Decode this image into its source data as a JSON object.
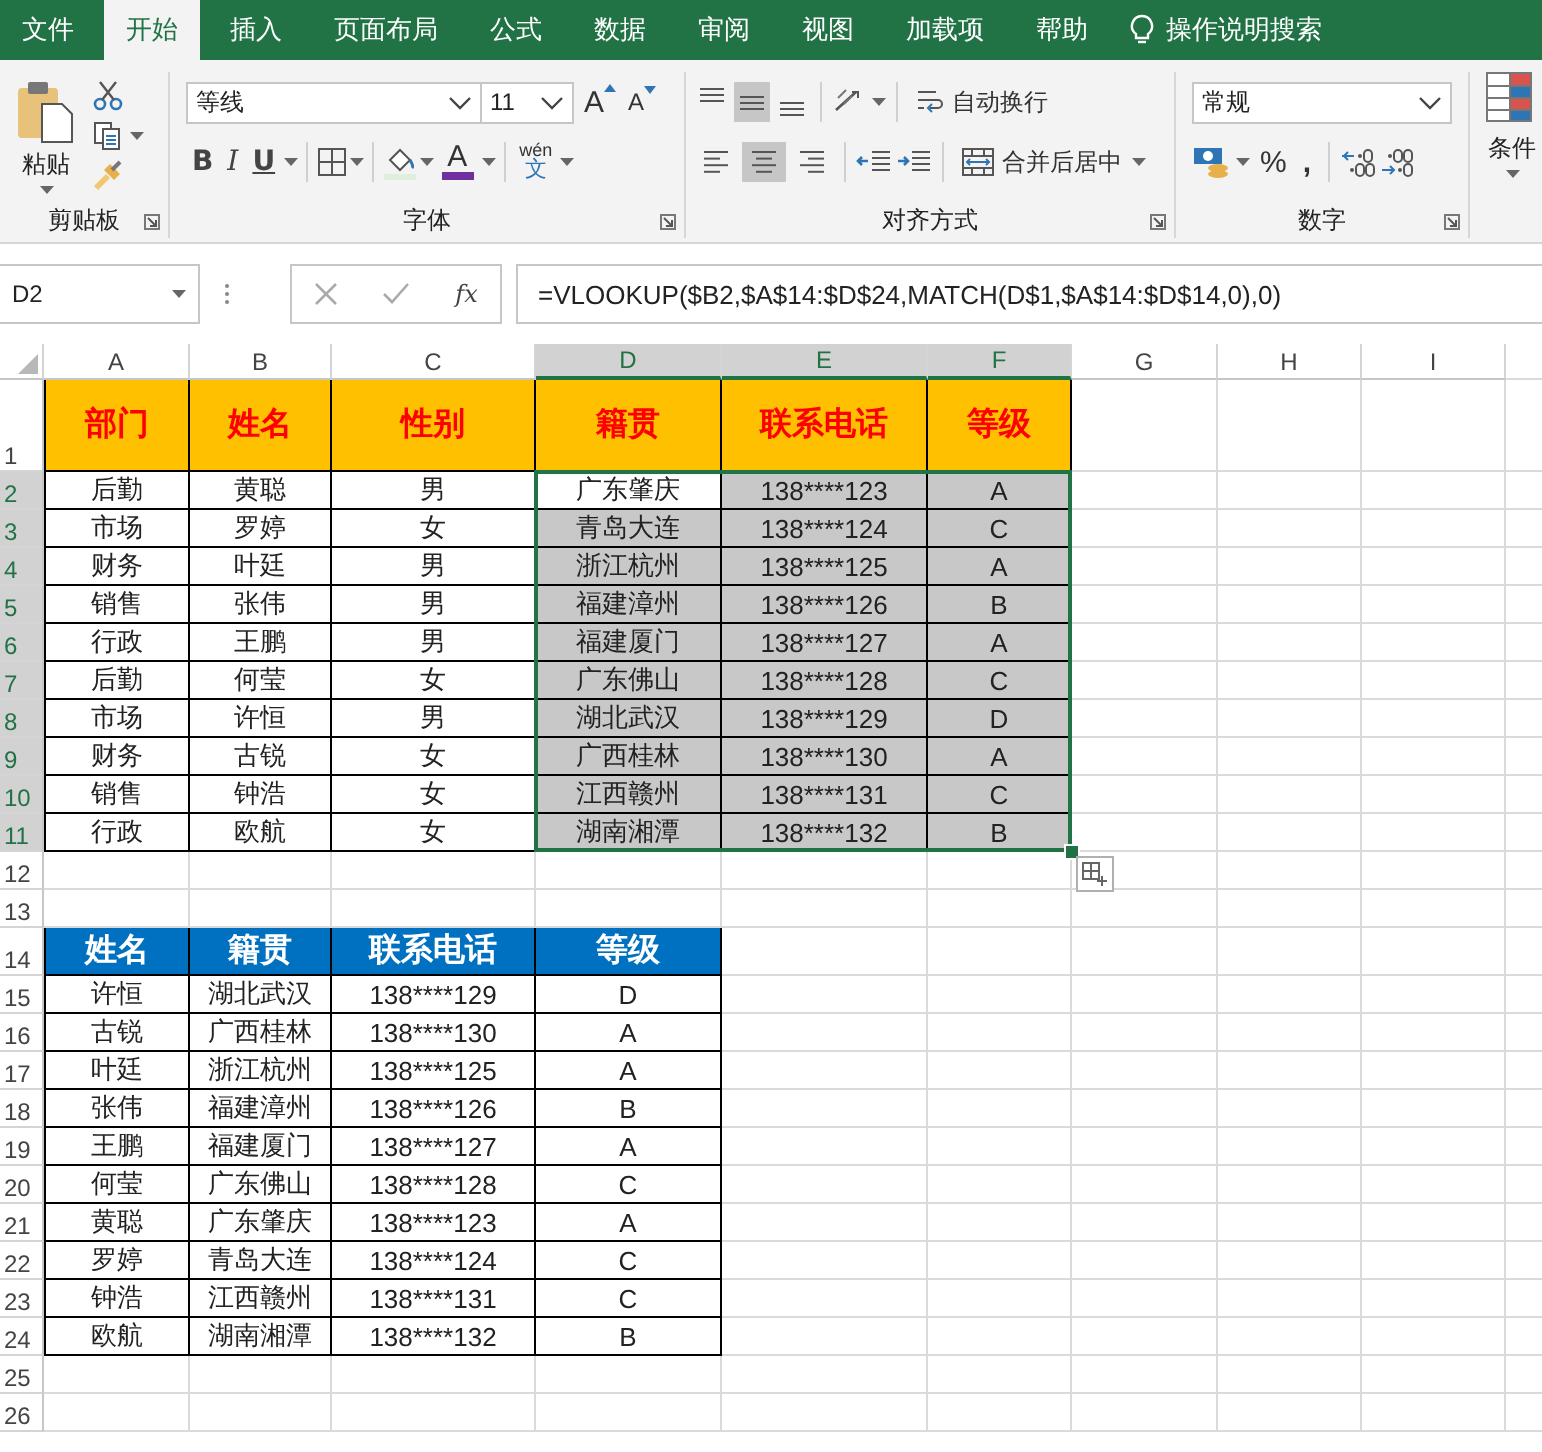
{
  "menu_tabs": [
    {
      "label": "文件",
      "selected": false
    },
    {
      "label": "开始",
      "selected": true
    },
    {
      "label": "插入",
      "selected": false
    },
    {
      "label": "页面布局",
      "selected": false
    },
    {
      "label": "公式",
      "selected": false
    },
    {
      "label": "数据",
      "selected": false
    },
    {
      "label": "审阅",
      "selected": false
    },
    {
      "label": "视图",
      "selected": false
    },
    {
      "label": "加载项",
      "selected": false
    },
    {
      "label": "帮助",
      "selected": false
    }
  ],
  "tell_me": "操作说明搜索",
  "ribbon": {
    "clipboard": {
      "paste": "粘贴",
      "group": "剪贴板"
    },
    "font": {
      "name": "等线",
      "size": "11",
      "grow": "A",
      "shrink": "A",
      "bold": "B",
      "italic": "I",
      "underline": "U",
      "font_color": "A",
      "phonetic_top": "wén",
      "phonetic_bottom": "文",
      "group": "字体"
    },
    "alignment": {
      "vertical": [
        {
          "selected": false
        },
        {
          "selected": true
        },
        {
          "selected": false
        }
      ],
      "horizontal": [
        {
          "selected": false
        },
        {
          "selected": true
        },
        {
          "selected": false
        }
      ],
      "wrap": "自动换行",
      "merge": "合并后居中",
      "group": "对齐方式"
    },
    "number": {
      "format": "常规",
      "percent": "%",
      "comma": ",",
      "group": "数字"
    },
    "styles": {
      "conditional": "条件"
    }
  },
  "formula_bar": {
    "name_box": "D2",
    "function_label": "fx",
    "formula": "=VLOOKUP($B2,$A$14:$D$24,MATCH(D$1,$A$14:$D$14,0),0)"
  },
  "sheet": {
    "columns": [
      {
        "label": "A",
        "selected": false
      },
      {
        "label": "B",
        "selected": false
      },
      {
        "label": "C",
        "selected": false
      },
      {
        "label": "D",
        "selected": true
      },
      {
        "label": "E",
        "selected": true
      },
      {
        "label": "F",
        "selected": true
      },
      {
        "label": "G",
        "selected": false
      },
      {
        "label": "H",
        "selected": false
      },
      {
        "label": "I",
        "selected": false
      }
    ],
    "rows": [
      {
        "number": "1",
        "selected": false,
        "cells": [
          {
            "text": "部门",
            "kind": "title"
          },
          {
            "text": "姓名",
            "kind": "title"
          },
          {
            "text": "性别",
            "kind": "title"
          },
          {
            "text": "籍贯",
            "kind": "title"
          },
          {
            "text": "联系电话",
            "kind": "title"
          },
          {
            "text": "等级",
            "kind": "title"
          }
        ]
      },
      {
        "number": "2",
        "selected": true,
        "cells": [
          {
            "text": "后勤",
            "kind": "data"
          },
          {
            "text": "黄聪",
            "kind": "data"
          },
          {
            "text": "男",
            "kind": "data"
          },
          {
            "text": "广东肇庆",
            "kind": "active"
          },
          {
            "text": "138****123",
            "kind": "highlight"
          },
          {
            "text": "A",
            "kind": "highlight"
          }
        ]
      },
      {
        "number": "3",
        "selected": true,
        "cells": [
          {
            "text": "市场",
            "kind": "data"
          },
          {
            "text": "罗婷",
            "kind": "data"
          },
          {
            "text": "女",
            "kind": "data"
          },
          {
            "text": "青岛大连",
            "kind": "highlight"
          },
          {
            "text": "138****124",
            "kind": "highlight"
          },
          {
            "text": "C",
            "kind": "highlight"
          }
        ]
      },
      {
        "number": "4",
        "selected": true,
        "cells": [
          {
            "text": "财务",
            "kind": "data"
          },
          {
            "text": "叶廷",
            "kind": "data"
          },
          {
            "text": "男",
            "kind": "data"
          },
          {
            "text": "浙江杭州",
            "kind": "highlight"
          },
          {
            "text": "138****125",
            "kind": "highlight"
          },
          {
            "text": "A",
            "kind": "highlight"
          }
        ]
      },
      {
        "number": "5",
        "selected": true,
        "cells": [
          {
            "text": "销售",
            "kind": "data"
          },
          {
            "text": "张伟",
            "kind": "data"
          },
          {
            "text": "男",
            "kind": "data"
          },
          {
            "text": "福建漳州",
            "kind": "highlight"
          },
          {
            "text": "138****126",
            "kind": "highlight"
          },
          {
            "text": "B",
            "kind": "highlight"
          }
        ]
      },
      {
        "number": "6",
        "selected": true,
        "cells": [
          {
            "text": "行政",
            "kind": "data"
          },
          {
            "text": "王鹏",
            "kind": "data"
          },
          {
            "text": "男",
            "kind": "data"
          },
          {
            "text": "福建厦门",
            "kind": "highlight"
          },
          {
            "text": "138****127",
            "kind": "highlight"
          },
          {
            "text": "A",
            "kind": "highlight"
          }
        ]
      },
      {
        "number": "7",
        "selected": true,
        "cells": [
          {
            "text": "后勤",
            "kind": "data"
          },
          {
            "text": "何莹",
            "kind": "data"
          },
          {
            "text": "女",
            "kind": "data"
          },
          {
            "text": "广东佛山",
            "kind": "highlight"
          },
          {
            "text": "138****128",
            "kind": "highlight"
          },
          {
            "text": "C",
            "kind": "highlight"
          }
        ]
      },
      {
        "number": "8",
        "selected": true,
        "cells": [
          {
            "text": "市场",
            "kind": "data"
          },
          {
            "text": "许恒",
            "kind": "data"
          },
          {
            "text": "男",
            "kind": "data"
          },
          {
            "text": "湖北武汉",
            "kind": "highlight"
          },
          {
            "text": "138****129",
            "kind": "highlight"
          },
          {
            "text": "D",
            "kind": "highlight"
          }
        ]
      },
      {
        "number": "9",
        "selected": true,
        "cells": [
          {
            "text": "财务",
            "kind": "data"
          },
          {
            "text": "古锐",
            "kind": "data"
          },
          {
            "text": "女",
            "kind": "data"
          },
          {
            "text": "广西桂林",
            "kind": "highlight"
          },
          {
            "text": "138****130",
            "kind": "highlight"
          },
          {
            "text": "A",
            "kind": "highlight"
          }
        ]
      },
      {
        "number": "10",
        "selected": true,
        "cells": [
          {
            "text": "销售",
            "kind": "data"
          },
          {
            "text": "钟浩",
            "kind": "data"
          },
          {
            "text": "女",
            "kind": "data"
          },
          {
            "text": "江西赣州",
            "kind": "highlight"
          },
          {
            "text": "138****131",
            "kind": "highlight"
          },
          {
            "text": "C",
            "kind": "highlight"
          }
        ]
      },
      {
        "number": "11",
        "selected": true,
        "cells": [
          {
            "text": "行政",
            "kind": "data"
          },
          {
            "text": "欧航",
            "kind": "data"
          },
          {
            "text": "女",
            "kind": "data"
          },
          {
            "text": "湖南湘潭",
            "kind": "highlight"
          },
          {
            "text": "138****132",
            "kind": "highlight"
          },
          {
            "text": "B",
            "kind": "highlight"
          }
        ]
      },
      {
        "number": "12",
        "selected": false
      },
      {
        "number": "13",
        "selected": false
      },
      {
        "number": "14",
        "selected": false,
        "cells": [
          {
            "text": "姓名",
            "kind": "band"
          },
          {
            "text": "籍贯",
            "kind": "band"
          },
          {
            "text": "联系电话",
            "kind": "band"
          },
          {
            "text": "等级",
            "kind": "band"
          }
        ]
      },
      {
        "number": "15",
        "selected": false,
        "cells": [
          {
            "text": "许恒",
            "kind": "data"
          },
          {
            "text": "湖北武汉",
            "kind": "data"
          },
          {
            "text": "138****129",
            "kind": "data"
          },
          {
            "text": "D",
            "kind": "data"
          }
        ]
      },
      {
        "number": "16",
        "selected": false,
        "cells": [
          {
            "text": "古锐",
            "kind": "data"
          },
          {
            "text": "广西桂林",
            "kind": "data"
          },
          {
            "text": "138****130",
            "kind": "data"
          },
          {
            "text": "A",
            "kind": "data"
          }
        ]
      },
      {
        "number": "17",
        "selected": false,
        "cells": [
          {
            "text": "叶廷",
            "kind": "data"
          },
          {
            "text": "浙江杭州",
            "kind": "data"
          },
          {
            "text": "138****125",
            "kind": "data"
          },
          {
            "text": "A",
            "kind": "data"
          }
        ]
      },
      {
        "number": "18",
        "selected": false,
        "cells": [
          {
            "text": "张伟",
            "kind": "data"
          },
          {
            "text": "福建漳州",
            "kind": "data"
          },
          {
            "text": "138****126",
            "kind": "data"
          },
          {
            "text": "B",
            "kind": "data"
          }
        ]
      },
      {
        "number": "19",
        "selected": false,
        "cells": [
          {
            "text": "王鹏",
            "kind": "data"
          },
          {
            "text": "福建厦门",
            "kind": "data"
          },
          {
            "text": "138****127",
            "kind": "data"
          },
          {
            "text": "A",
            "kind": "data"
          }
        ]
      },
      {
        "number": "20",
        "selected": false,
        "cells": [
          {
            "text": "何莹",
            "kind": "data"
          },
          {
            "text": "广东佛山",
            "kind": "data"
          },
          {
            "text": "138****128",
            "kind": "data"
          },
          {
            "text": "C",
            "kind": "data"
          }
        ]
      },
      {
        "number": "21",
        "selected": false,
        "cells": [
          {
            "text": "黄聪",
            "kind": "data"
          },
          {
            "text": "广东肇庆",
            "kind": "data"
          },
          {
            "text": "138****123",
            "kind": "data"
          },
          {
            "text": "A",
            "kind": "data"
          }
        ]
      },
      {
        "number": "22",
        "selected": false,
        "cells": [
          {
            "text": "罗婷",
            "kind": "data"
          },
          {
            "text": "青岛大连",
            "kind": "data"
          },
          {
            "text": "138****124",
            "kind": "data"
          },
          {
            "text": "C",
            "kind": "data"
          }
        ]
      },
      {
        "number": "23",
        "selected": false,
        "cells": [
          {
            "text": "钟浩",
            "kind": "data"
          },
          {
            "text": "江西赣州",
            "kind": "data"
          },
          {
            "text": "138****131",
            "kind": "data"
          },
          {
            "text": "C",
            "kind": "data"
          }
        ]
      },
      {
        "number": "24",
        "selected": false,
        "cells": [
          {
            "text": "欧航",
            "kind": "data"
          },
          {
            "text": "湖南湘潭",
            "kind": "data"
          },
          {
            "text": "138****132",
            "kind": "data"
          },
          {
            "text": "B",
            "kind": "data"
          }
        ]
      },
      {
        "number": "25",
        "selected": false
      },
      {
        "number": "26",
        "selected": false
      }
    ]
  }
}
